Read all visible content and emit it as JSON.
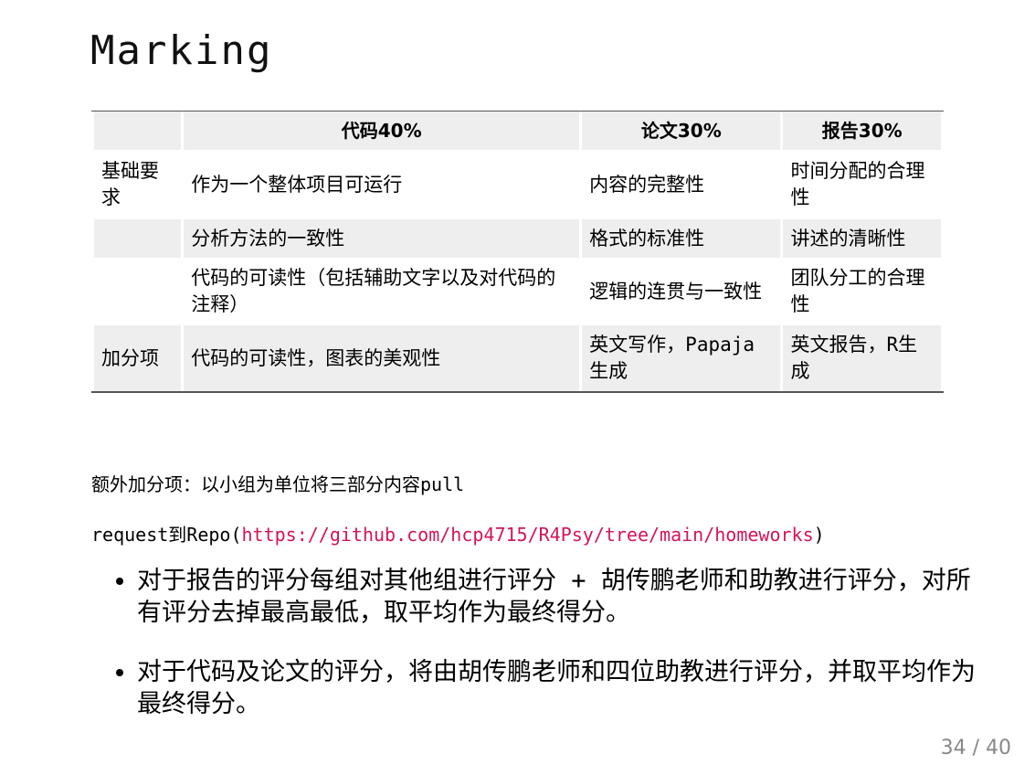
{
  "title": "Marking",
  "table": {
    "headers": [
      "",
      "代码40%",
      "论文30%",
      "报告30%"
    ],
    "rows": [
      [
        "基础要求",
        "作为一个整体项目可运行",
        "内容的完整性",
        "时间分配的合理性"
      ],
      [
        "",
        "分析方法的一致性",
        "格式的标准性",
        "讲述的清晰性"
      ],
      [
        "",
        "代码的可读性（包括辅助文字以及对代码的注释）",
        "逻辑的连贯与一致性",
        "团队分工的合理性"
      ],
      [
        "加分项",
        "代码的可读性，图表的美观性",
        "英文写作，Papaja生成",
        "英文报告，R生成"
      ]
    ]
  },
  "extra": {
    "line1": "额外加分项：以小组为单位将三部分内容pull",
    "line2_prefix": "request到Repo(",
    "link": "https://github.com/hcp4715/R4Psy/tree/main/homeworks",
    "line2_suffix": ")"
  },
  "bullets": [
    "对于报告的评分每组对其他组进行评分 + 胡传鹏老师和助教进行评分，对所有评分去掉最高最低，取平均作为最终得分。",
    "对于代码及论文的评分，将由胡传鹏老师和四位助教进行评分，并取平均作为最终得分。"
  ],
  "page": "34 / 40"
}
